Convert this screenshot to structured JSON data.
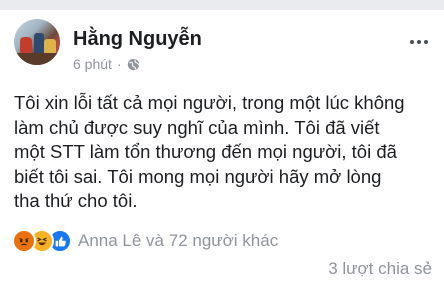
{
  "post": {
    "author": "Hằng Nguyễn",
    "time": "6 phút",
    "separator": "·",
    "privacy_icon": "globe-icon",
    "lines": [
      "Tôi xin lỗi tất cả mọi người, trong một lúc không",
      "làm chủ được suy nghĩ của mình. Tôi đã viết",
      "một STT làm tổn thương đến mọi người, tôi đã",
      "biết tôi sai. Tôi mong mọi người hãy mở lòng",
      "tha thứ cho tôi."
    ],
    "reactions": {
      "types": [
        "angry",
        "haha",
        "like"
      ],
      "summary": "Anna Lê và 72 người khác"
    },
    "shares": "3 lượt chia sẻ"
  },
  "colors": {
    "link_blue": "#1877f2",
    "meta_gray": "#90949c",
    "angry": "#e9710f",
    "haha": "#f7b125"
  }
}
